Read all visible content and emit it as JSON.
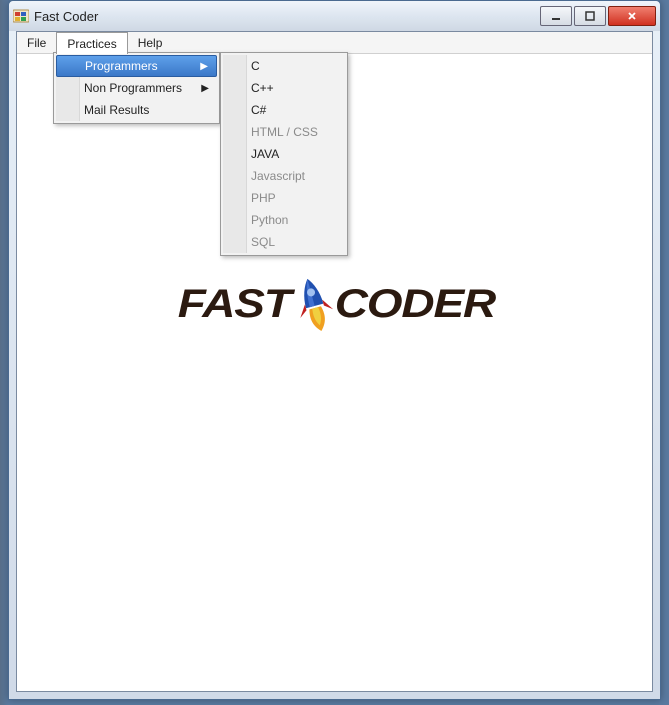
{
  "window": {
    "title": "Fast Coder"
  },
  "menubar": {
    "file": "File",
    "practices": "Practices",
    "help": "Help"
  },
  "practices_menu": {
    "programmers": "Programmers",
    "non_programmers": "Non Programmers",
    "mail_results": "Mail Results"
  },
  "programmers_submenu": {
    "items": [
      {
        "label": "C",
        "enabled": true
      },
      {
        "label": "C++",
        "enabled": true
      },
      {
        "label": "C#",
        "enabled": true
      },
      {
        "label": "HTML / CSS",
        "enabled": false
      },
      {
        "label": "JAVA",
        "enabled": true
      },
      {
        "label": "Javascript",
        "enabled": false
      },
      {
        "label": "PHP",
        "enabled": false
      },
      {
        "label": "Python",
        "enabled": false
      },
      {
        "label": "SQL",
        "enabled": false
      }
    ]
  },
  "logo": {
    "left": "FAST",
    "right": "CODER"
  }
}
